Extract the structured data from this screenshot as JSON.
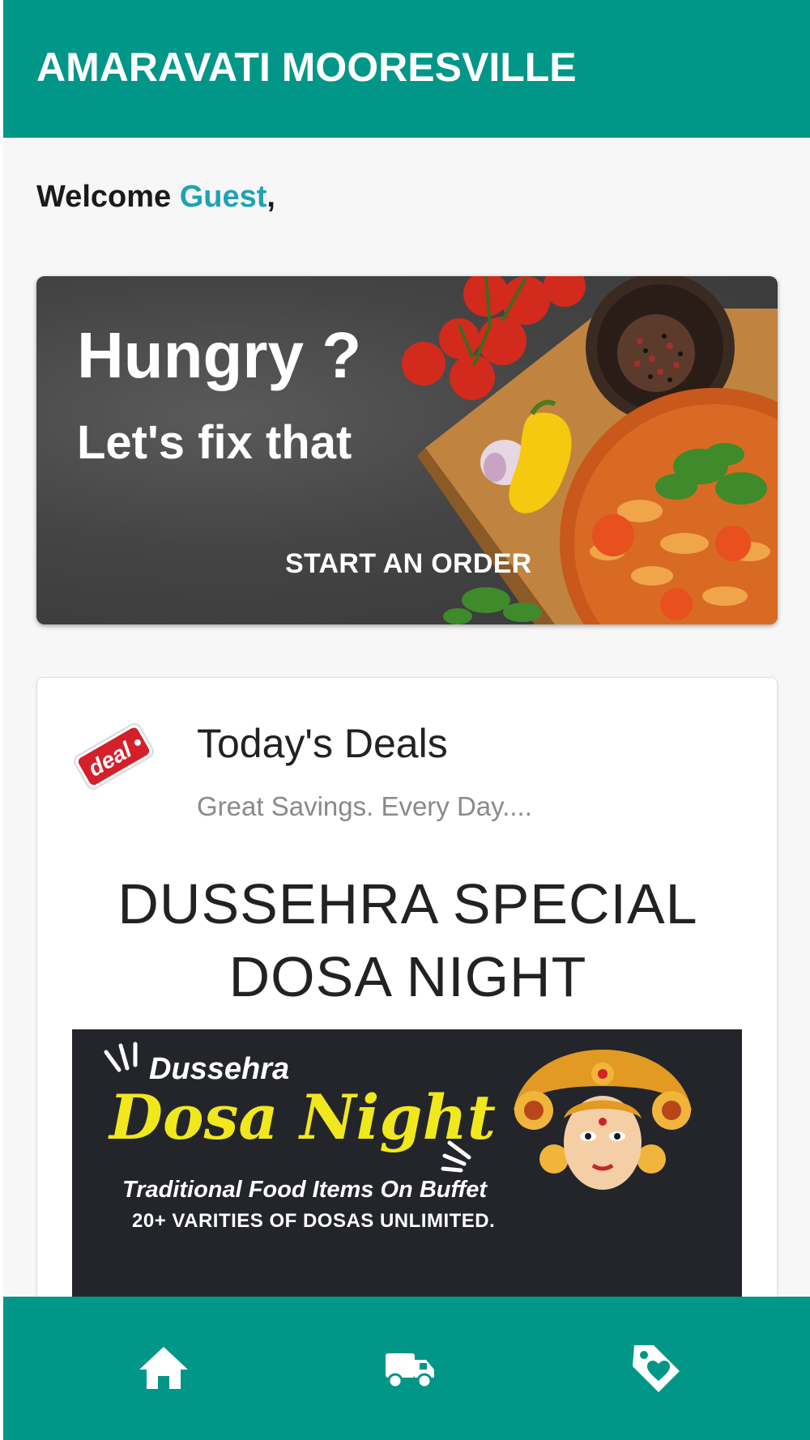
{
  "app_bar": {
    "title": "AMARAVATI MOORESVILLE"
  },
  "welcome": {
    "prefix": "Welcome ",
    "user": "Guest",
    "suffix": ","
  },
  "hero": {
    "title": "Hungry ?",
    "subtitle": "Let's fix that",
    "cta_label": "START AN ORDER"
  },
  "deals": {
    "icon_text": "deal",
    "title": "Today's Deals",
    "subtitle": "Great Savings. Every Day....",
    "headline_line1": "DUSSEHRA SPECIAL",
    "headline_line2": "DOSA NIGHT",
    "banner": {
      "line1": "Dussehra",
      "line2": "Dosa Night",
      "line3": "Traditional Food Items On Buffet",
      "line4": "20+ VARITIES OF DOSAS UNLIMITED."
    }
  },
  "bottom_nav": {
    "items": [
      {
        "icon": "home-icon"
      },
      {
        "icon": "delivery-truck-icon"
      },
      {
        "icon": "deals-tag-icon"
      }
    ]
  },
  "colors": {
    "primary": "#009688",
    "accent": "#1fa2b5",
    "banner_yellow": "#f0e81c"
  }
}
